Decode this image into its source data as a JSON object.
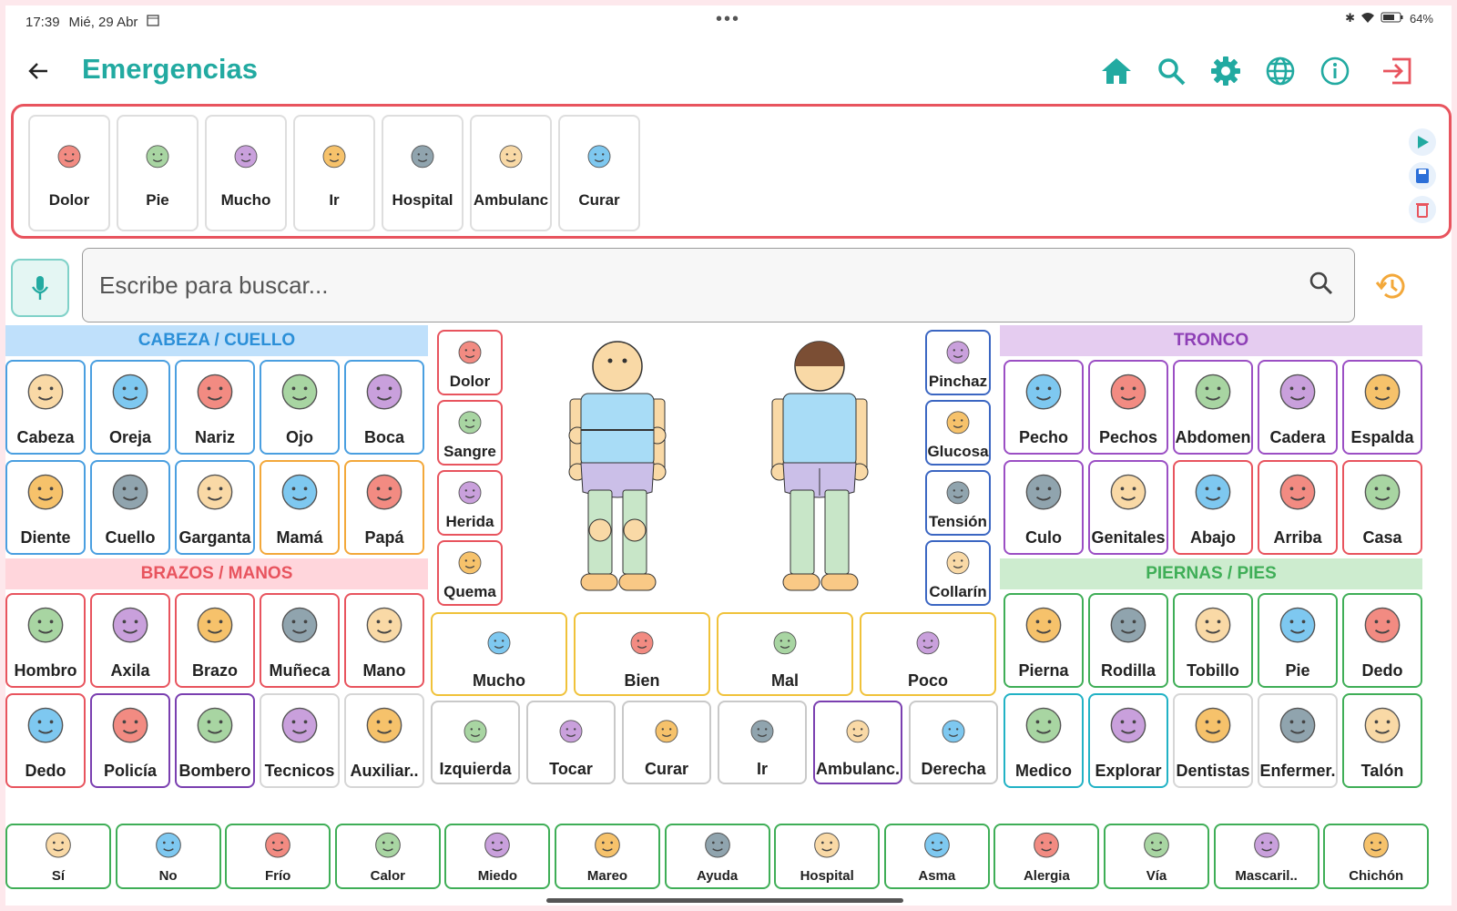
{
  "status": {
    "time": "17:39",
    "date": "Mié, 29 Abr",
    "dots": "•••",
    "battery": "64%"
  },
  "header": {
    "title": "Emergencias"
  },
  "sentence": {
    "items": [
      {
        "label": "Dolor",
        "icon": "pain-face-icon"
      },
      {
        "label": "Pie",
        "icon": "foot-icon"
      },
      {
        "label": "Mucho",
        "icon": "much-wedge-icon"
      },
      {
        "label": "Ir",
        "icon": "walking-person-icon"
      },
      {
        "label": "Hospital",
        "icon": "hospital-icon"
      },
      {
        "label": "Ambulanc",
        "icon": "ambulance-icon"
      },
      {
        "label": "Curar",
        "icon": "bandage-hand-icon"
      }
    ]
  },
  "search": {
    "placeholder": "Escribe para buscar..."
  },
  "sections": {
    "head": "CABEZA / CUELLO",
    "arms": "BRAZOS / MANOS",
    "trunk": "TRONCO",
    "legs": "PIERNAS / PIES"
  },
  "head_cards": [
    {
      "label": "Cabeza",
      "color": "blue"
    },
    {
      "label": "Oreja",
      "color": "blue"
    },
    {
      "label": "Nariz",
      "color": "blue"
    },
    {
      "label": "Ojo",
      "color": "blue"
    },
    {
      "label": "Boca",
      "color": "blue"
    },
    {
      "label": "Diente",
      "color": "blue"
    },
    {
      "label": "Cuello",
      "color": "blue"
    },
    {
      "label": "Garganta",
      "color": "blue"
    },
    {
      "label": "Mamá",
      "color": "orange"
    },
    {
      "label": "Papá",
      "color": "orange"
    }
  ],
  "arm_cards": [
    {
      "label": "Hombro",
      "color": "red"
    },
    {
      "label": "Axila",
      "color": "red"
    },
    {
      "label": "Brazo",
      "color": "red"
    },
    {
      "label": "Muñeca",
      "color": "red"
    },
    {
      "label": "Mano",
      "color": "red"
    },
    {
      "label": "Dedo",
      "color": "red"
    },
    {
      "label": "Policía",
      "color": "purple"
    },
    {
      "label": "Bombero",
      "color": "purple"
    },
    {
      "label": "Tecnicos",
      "color": "grey"
    },
    {
      "label": "Auxiliar..",
      "color": "grey"
    }
  ],
  "trunk_cards": [
    {
      "label": "Pecho",
      "color": "violet"
    },
    {
      "label": "Pechos",
      "color": "violet"
    },
    {
      "label": "Abdomen",
      "color": "violet"
    },
    {
      "label": "Cadera",
      "color": "violet"
    },
    {
      "label": "Espalda",
      "color": "violet"
    },
    {
      "label": "Culo",
      "color": "violet"
    },
    {
      "label": "Genitales",
      "color": "violet"
    },
    {
      "label": "Abajo",
      "color": "red"
    },
    {
      "label": "Arriba",
      "color": "red"
    },
    {
      "label": "Casa",
      "color": "red"
    }
  ],
  "leg_cards": [
    {
      "label": "Pierna",
      "color": "green"
    },
    {
      "label": "Rodilla",
      "color": "green"
    },
    {
      "label": "Tobillo",
      "color": "green"
    },
    {
      "label": "Pie",
      "color": "green"
    },
    {
      "label": "Dedo",
      "color": "green"
    },
    {
      "label": "Medico",
      "color": "teal"
    },
    {
      "label": "Explorar",
      "color": "teal"
    },
    {
      "label": "Dentistas",
      "color": "grey"
    },
    {
      "label": "Enfermer.",
      "color": "grey"
    },
    {
      "label": "Talón",
      "color": "green"
    }
  ],
  "mid_left": [
    "Dolor",
    "Sangre",
    "Herida",
    "Quema"
  ],
  "mid_right": [
    "Pinchaz",
    "Glucosa",
    "Tensión",
    "Collarín"
  ],
  "mid_wide": [
    "Mucho",
    "Bien",
    "Mal",
    "Poco"
  ],
  "mid_actions": [
    {
      "label": "Izquierda",
      "color": "grey"
    },
    {
      "label": "Tocar",
      "color": "grey"
    },
    {
      "label": "Curar",
      "color": "grey"
    },
    {
      "label": "Ir",
      "color": "grey"
    },
    {
      "label": "Ambulanc.",
      "color": "purple"
    },
    {
      "label": "Derecha",
      "color": "grey"
    }
  ],
  "bottom": [
    "Sí",
    "No",
    "Frío",
    "Calor",
    "Miedo",
    "Mareo",
    "Ayuda",
    "Hospital",
    "Asma",
    "Alergia",
    "Vía",
    "Mascaril..",
    "Chichón"
  ],
  "colors": {
    "accent": "#22aaa1",
    "red": "#e8545e",
    "head_bg": "#bfe0fb",
    "arms_bg": "#ffd6dc",
    "trunk_bg": "#e5ccf0",
    "legs_bg": "#cdeccf"
  }
}
